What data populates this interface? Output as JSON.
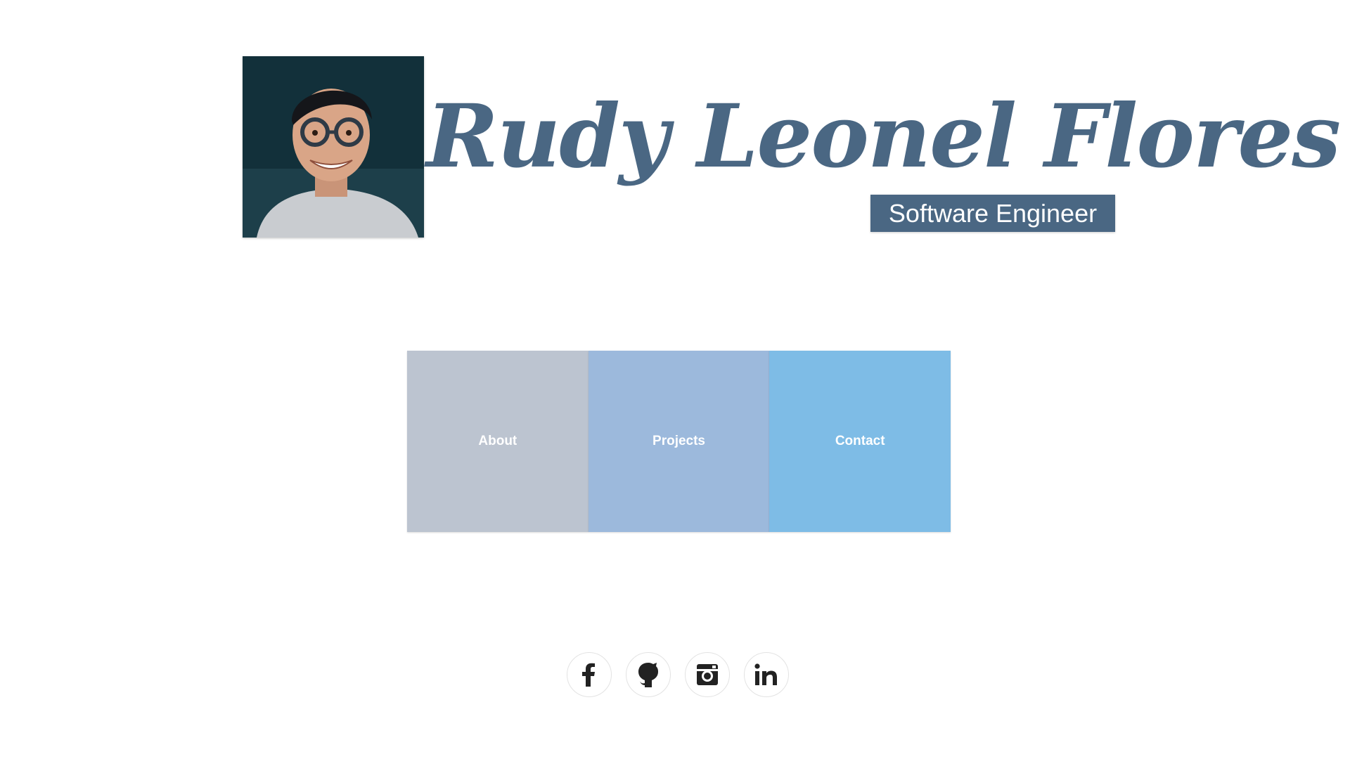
{
  "header": {
    "name": "Rudy Leonel Flores",
    "role": "Software Engineer"
  },
  "nav": {
    "tiles": [
      {
        "label": "About",
        "color": "#bcc4d0"
      },
      {
        "label": "Projects",
        "color": "#9cb9dc"
      },
      {
        "label": "Contact",
        "color": "#7ebce6"
      }
    ]
  },
  "socials": [
    {
      "icon": "facebook-icon"
    },
    {
      "icon": "github-icon"
    },
    {
      "icon": "instagram-icon"
    },
    {
      "icon": "linkedin-icon"
    }
  ],
  "colors": {
    "brand": "#4a6783",
    "icon": "#222222"
  }
}
